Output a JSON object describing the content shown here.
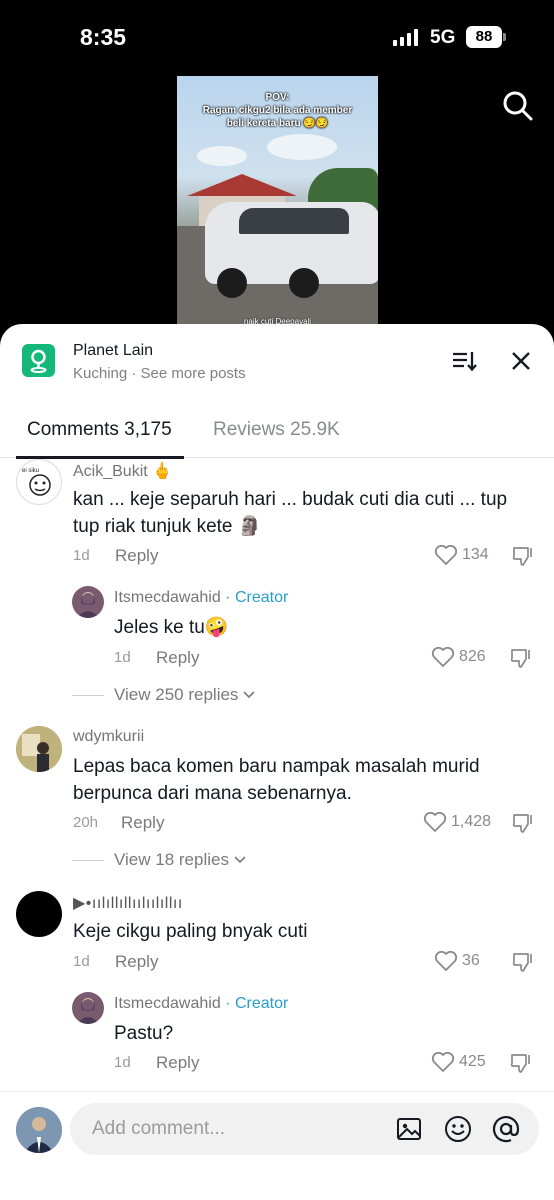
{
  "status_bar": {
    "time": "8:35",
    "network": "5G",
    "battery": "88"
  },
  "video": {
    "caption_top": "POV:",
    "caption_line2": "Ragam cikgu2 bila ada member",
    "caption_line3": "beli kereta baru 😏😏",
    "caption_bottom": "naik cuti Deepavali"
  },
  "place": {
    "name": "Planet Lain",
    "subtitle": "Kuching · See more posts"
  },
  "tabs": {
    "comments": "Comments 3,175",
    "reviews": "Reviews 25.9K"
  },
  "comments": [
    {
      "user": "Acik_Bukit 🖕",
      "text_line1": "kan ... keje separuh hari ... budak cuti dia cuti ... tup",
      "text_line2": "tup riak tunjuk kete 🗿",
      "time": "1d",
      "reply": "Reply",
      "likes": "134"
    },
    {
      "user": "Itsmecdawahid",
      "badge": "· Creator",
      "text": "Jeles ke tu🤪",
      "time": "1d",
      "reply": "Reply",
      "likes": "826"
    },
    {
      "view_replies": "View 250 replies"
    },
    {
      "user": "wdymkurii",
      "text_line1": "Lepas baca komen baru nampak masalah murid",
      "text_line2": "berpunca dari mana sebenarnya.",
      "time": "20h",
      "reply": "Reply",
      "likes": "1,428"
    },
    {
      "view_replies": "View 18 replies"
    },
    {
      "user": "▶•ıılıllıllıılıılıllıı",
      "text": "Keje cikgu paling bnyak cuti",
      "time": "1d",
      "reply": "Reply",
      "likes": "36"
    },
    {
      "user": "Itsmecdawahid",
      "badge": "· Creator",
      "text": "Pastu?",
      "time": "1d",
      "reply": "Reply",
      "likes": "425"
    }
  ],
  "input": {
    "placeholder": "Add comment..."
  },
  "colors": {
    "accent_creator": "#2a9ecb",
    "place_icon": "#15b87b"
  }
}
